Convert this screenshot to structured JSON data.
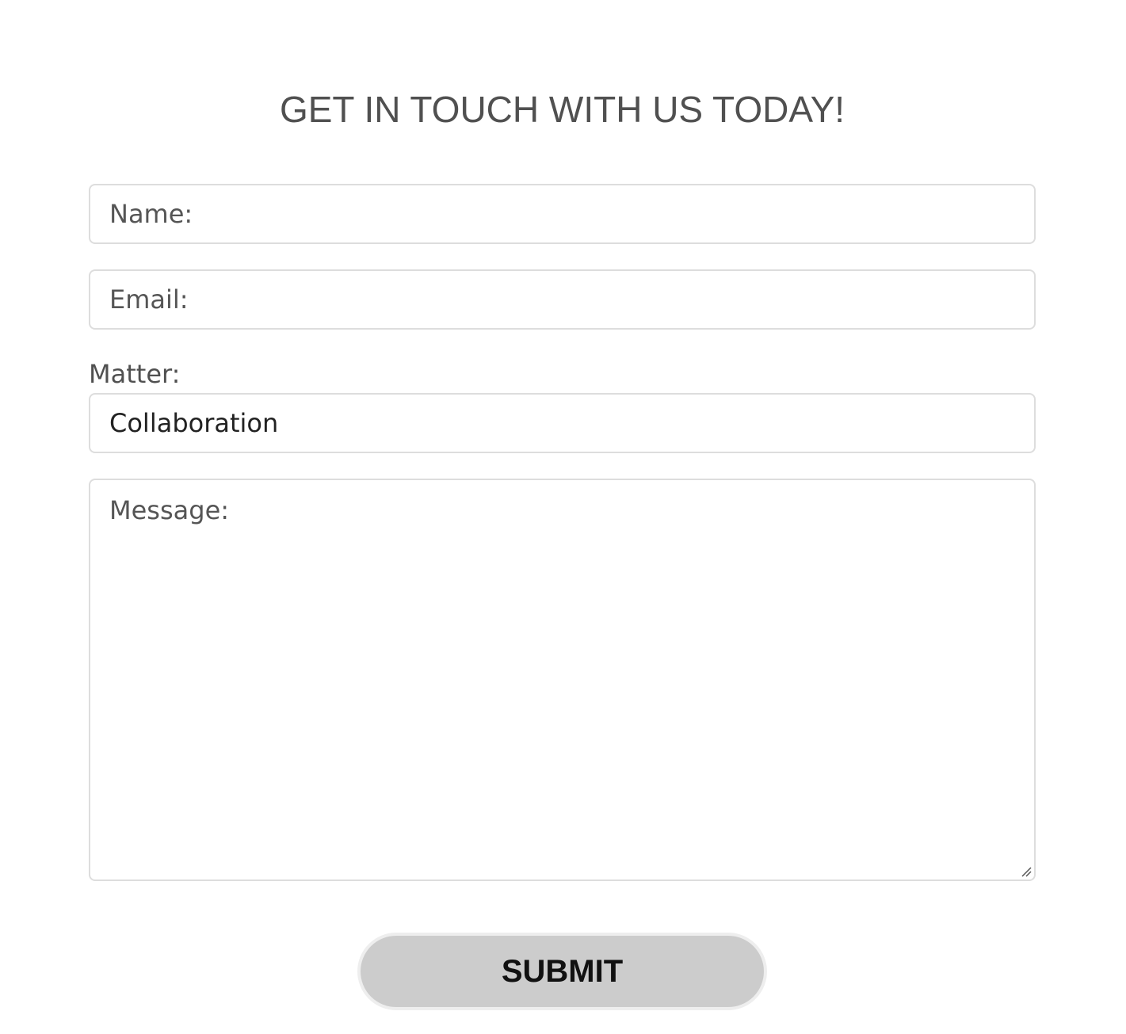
{
  "header": {
    "title": "GET IN TOUCH WITH US TODAY!"
  },
  "form": {
    "name": {
      "placeholder": "Name:",
      "value": ""
    },
    "email": {
      "placeholder": "Email:",
      "value": ""
    },
    "matter": {
      "label": "Matter:",
      "selected": "Collaboration"
    },
    "message": {
      "placeholder": "Message:",
      "value": ""
    },
    "submit_label": "SUBMIT"
  },
  "colors": {
    "text": "#505050",
    "border": "#dddddd",
    "button_bg": "#cccccc",
    "button_text": "#111111"
  },
  "icons": {
    "resize": "resize-grip-icon"
  }
}
